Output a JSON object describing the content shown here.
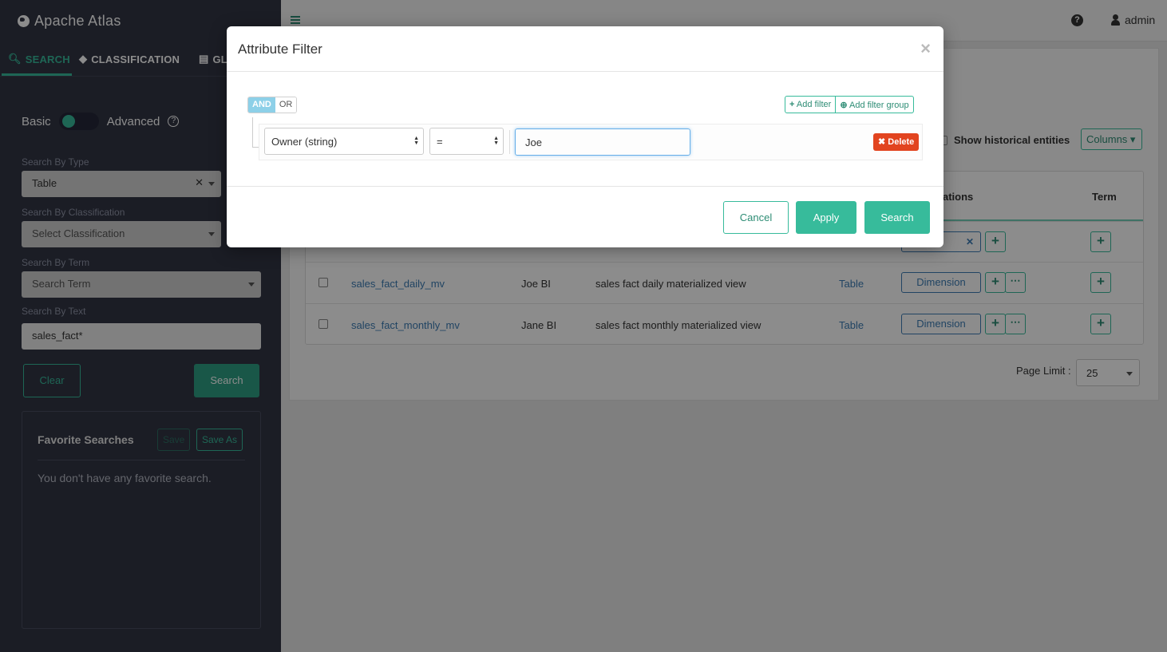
{
  "app": {
    "title": "Apache Atlas"
  },
  "sidebar": {
    "tabs": [
      {
        "label": "SEARCH",
        "icon": "search-icon",
        "active": true
      },
      {
        "label": "CLASSIFICATION",
        "icon": "tag-icon",
        "active": false
      },
      {
        "label": "GL",
        "icon": "folder-icon",
        "active": false
      }
    ],
    "toggle": {
      "left_label": "Basic",
      "right_label": "Advanced"
    },
    "search_by_type": {
      "label": "Search By Type",
      "value": "Table"
    },
    "search_by_classification": {
      "label": "Search By Classification",
      "placeholder": "Select Classification"
    },
    "search_by_term": {
      "label": "Search By Term",
      "placeholder": "Search Term"
    },
    "search_by_text": {
      "label": "Search By Text",
      "value": "sales_fact*"
    },
    "clear_label": "Clear",
    "search_label": "Search",
    "favorites": {
      "title": "Favorite Searches",
      "save_label": "Save",
      "save_as_label": "Save As",
      "empty_text": "You don't have any favorite search."
    }
  },
  "header": {
    "user": "admin"
  },
  "results": {
    "show_historical_label": "Show historical entities",
    "columns_label": "Columns",
    "headers": {
      "classifications": "ations",
      "term": "Term"
    },
    "rows": [
      {
        "name": "",
        "owner": "",
        "description": "",
        "type": "",
        "classification": ""
      },
      {
        "name": "sales_fact_daily_mv",
        "owner": "Joe BI",
        "description": "sales fact daily materialized view",
        "type": "Table",
        "classification": "Dimension"
      },
      {
        "name": "sales_fact_monthly_mv",
        "owner": "Jane BI",
        "description": "sales fact monthly materialized view",
        "type": "Table",
        "classification": "Dimension"
      }
    ],
    "page_limit_label": "Page Limit :",
    "page_limit_value": "25"
  },
  "modal": {
    "title": "Attribute Filter",
    "and_label": "AND",
    "or_label": "OR",
    "add_filter_label": "Add filter",
    "add_filter_group_label": "Add filter group",
    "rule": {
      "field": "Owner (string)",
      "operator": "=",
      "value": "Joe"
    },
    "delete_label": "Delete",
    "cancel_label": "Cancel",
    "apply_label": "Apply",
    "search_label": "Search"
  },
  "colors": {
    "accent": "#37bb9b",
    "sidebar_bg": "#323544",
    "danger": "#e2441f",
    "link": "#3c7cb4"
  }
}
